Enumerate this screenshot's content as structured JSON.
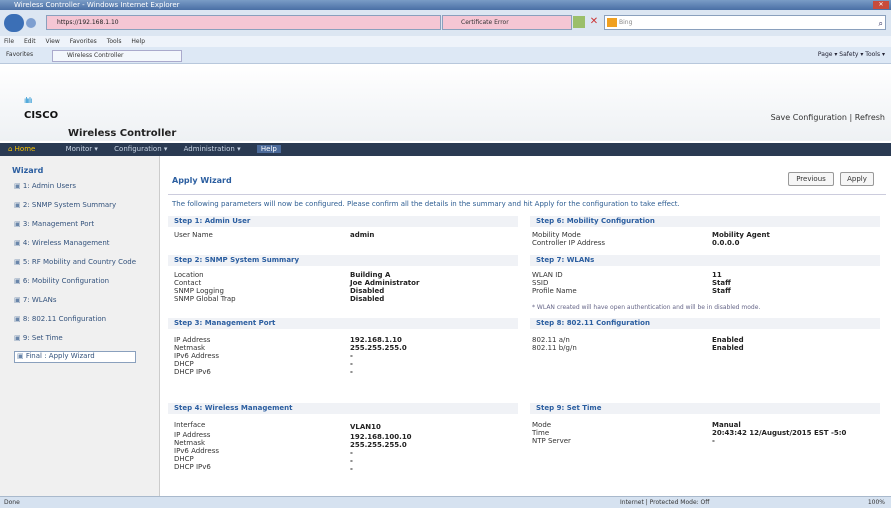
{
  "browser": {
    "title": "Wireless Controller - Windows Internet Explorer",
    "url": "https://192.168.1.10",
    "cert": "Certificate Error",
    "search_placeholder": "Bing",
    "menu": [
      "File",
      "Edit",
      "View",
      "Favorites",
      "Tools",
      "Help"
    ],
    "favorites_label": "Favorites",
    "tab": "Wireless Controller",
    "tools": "Page ▾  Safety ▾  Tools ▾",
    "status_left": "Done",
    "status_zone": "Internet | Protected Mode: Off",
    "zoom": "100%"
  },
  "app": {
    "brand": "CISCO",
    "product": "Wireless Controller",
    "save": "Save Configuration | Refresh"
  },
  "nav": {
    "home": "Home",
    "items": [
      "Monitor ▾",
      "Configuration ▾",
      "Administration ▾",
      "Help"
    ]
  },
  "wizard": {
    "title": "Wizard",
    "items": [
      "1: Admin Users",
      "2: SNMP System Summary",
      "3: Management Port",
      "4: Wireless Management",
      "5: RF Mobility and Country Code",
      "6: Mobility Configuration",
      "7: WLANs",
      "8: 802.11 Configuration",
      "9: Set Time",
      "Final : Apply Wizard"
    ]
  },
  "page": {
    "title": "Apply Wizard",
    "previous": "Previous",
    "apply": "Apply",
    "intro": "The following parameters will now be configured. Please confirm all the details in the summary and hit Apply for the configuration to take effect."
  },
  "steps": {
    "s1": {
      "title": "Step 1: Admin User",
      "labels": [
        "User Name"
      ],
      "values": [
        "admin"
      ]
    },
    "s2": {
      "title": "Step 2: SNMP System Summary",
      "labels": [
        "Location",
        "Contact",
        "SNMP Logging",
        "SNMP Global Trap"
      ],
      "values": [
        "Building A",
        "Joe Administrator",
        "Disabled",
        "Disabled"
      ]
    },
    "s3": {
      "title": "Step 3: Management Port",
      "labels": [
        "IP Address",
        "Netmask",
        "IPv6 Address",
        "DHCP",
        "DHCP IPv6"
      ],
      "values": [
        "192.168.1.10",
        "255.255.255.0",
        "-",
        "-",
        "-"
      ]
    },
    "s4": {
      "title": "Step 4: Wireless Management",
      "labels": [
        "Interface",
        "IP Address",
        "Netmask",
        "IPv6 Address",
        "DHCP",
        "DHCP IPv6"
      ],
      "values": [
        "VLAN10",
        "192.168.100.10",
        "255.255.255.0",
        "-",
        "-",
        "-"
      ]
    },
    "s6": {
      "title": "Step 6: Mobility Configuration",
      "labels": [
        "Mobility Mode",
        "Controller IP Address"
      ],
      "values": [
        "Mobility Agent",
        "0.0.0.0"
      ]
    },
    "s7": {
      "title": "Step 7: WLANs",
      "labels": [
        "WLAN ID",
        "SSID",
        "Profile Name"
      ],
      "values": [
        "11",
        "Staff",
        "Staff"
      ],
      "note": "* WLAN created will have open authentication and will be in disabled mode."
    },
    "s8": {
      "title": "Step 8: 802.11 Configuration",
      "labels": [
        "802.11 a/n",
        "802.11 b/g/n"
      ],
      "values": [
        "Enabled",
        "Enabled"
      ]
    },
    "s9": {
      "title": "Step 9: Set Time",
      "labels": [
        "Mode",
        "Time",
        "NTP Server"
      ],
      "values": [
        "Manual",
        "20:43:42 12/August/2015 EST -5:0",
        "-"
      ]
    }
  }
}
